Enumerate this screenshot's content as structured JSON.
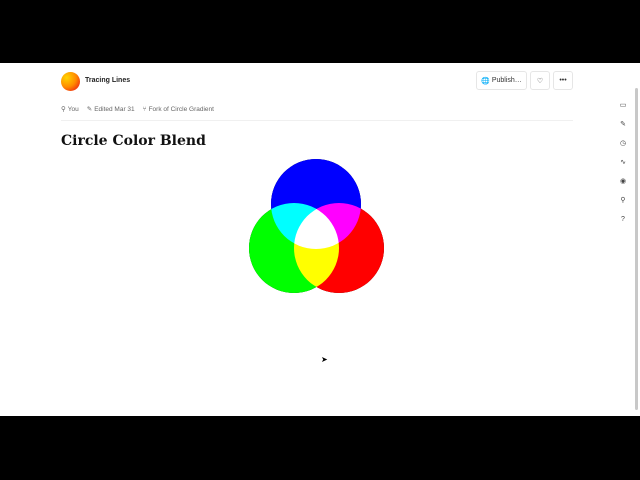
{
  "header": {
    "title": "Tracing Lines",
    "publish_label": "Publish…",
    "like_icon": "heart-icon",
    "more_icon": "ellipsis-icon"
  },
  "meta": {
    "author": "You",
    "edited": "Edited Mar 31",
    "fork": "Fork of Circle Gradient"
  },
  "document": {
    "title": "Circle Color Blend"
  },
  "figure": {
    "circles": [
      {
        "name": "blue",
        "color": "#0000ff"
      },
      {
        "name": "green",
        "color": "#00ff00"
      },
      {
        "name": "red",
        "color": "#ff0000"
      }
    ]
  },
  "sidebar": {
    "icons": [
      "comment-icon",
      "paperclip-icon",
      "history-icon",
      "link-icon",
      "eye-icon",
      "search-icon",
      "help-icon"
    ]
  }
}
